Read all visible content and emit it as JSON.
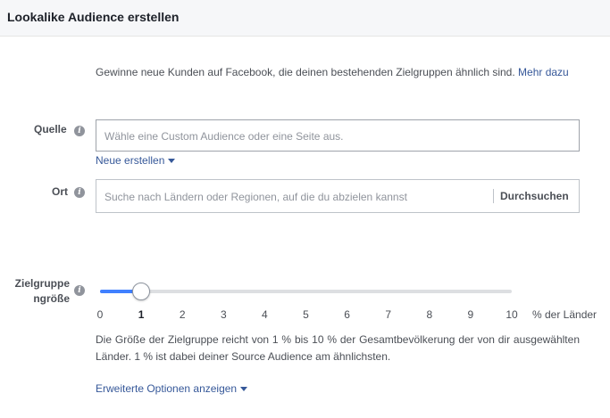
{
  "header": {
    "title": "Lookalike Audience erstellen"
  },
  "intro": {
    "text": "Gewinne neue Kunden auf Facebook, die deinen bestehenden Zielgruppen ähnlich sind.",
    "link": "Mehr dazu"
  },
  "source": {
    "label": "Quelle",
    "placeholder": "Wähle eine Custom Audience oder eine Seite aus.",
    "new_link": "Neue erstellen"
  },
  "location": {
    "label": "Ort",
    "placeholder": "Suche nach Ländern oder Regionen, auf die du abzielen kannst",
    "browse": "Durchsuchen"
  },
  "size": {
    "label_line1": "Zielgruppe",
    "label_line2": "ngröße",
    "ticks": [
      "0",
      "1",
      "2",
      "3",
      "4",
      "5",
      "6",
      "7",
      "8",
      "9",
      "10"
    ],
    "selected_value": 1,
    "min": 0,
    "max": 10,
    "unit": "% der Länder",
    "description": "Die Größe der Zielgruppe reicht von 1 % bis 10 % der Gesamtbevölkerung der von dir ausgewählten Länder. 1 % ist dabei deiner Source Audience am ähnlichsten."
  },
  "advanced": {
    "label": "Erweiterte Optionen anzeigen"
  },
  "colors": {
    "accent": "#4080ff",
    "link": "#365899",
    "header_bg": "#f6f7f9"
  },
  "icons": {
    "info": "info-icon",
    "caret": "caret-down-icon"
  }
}
